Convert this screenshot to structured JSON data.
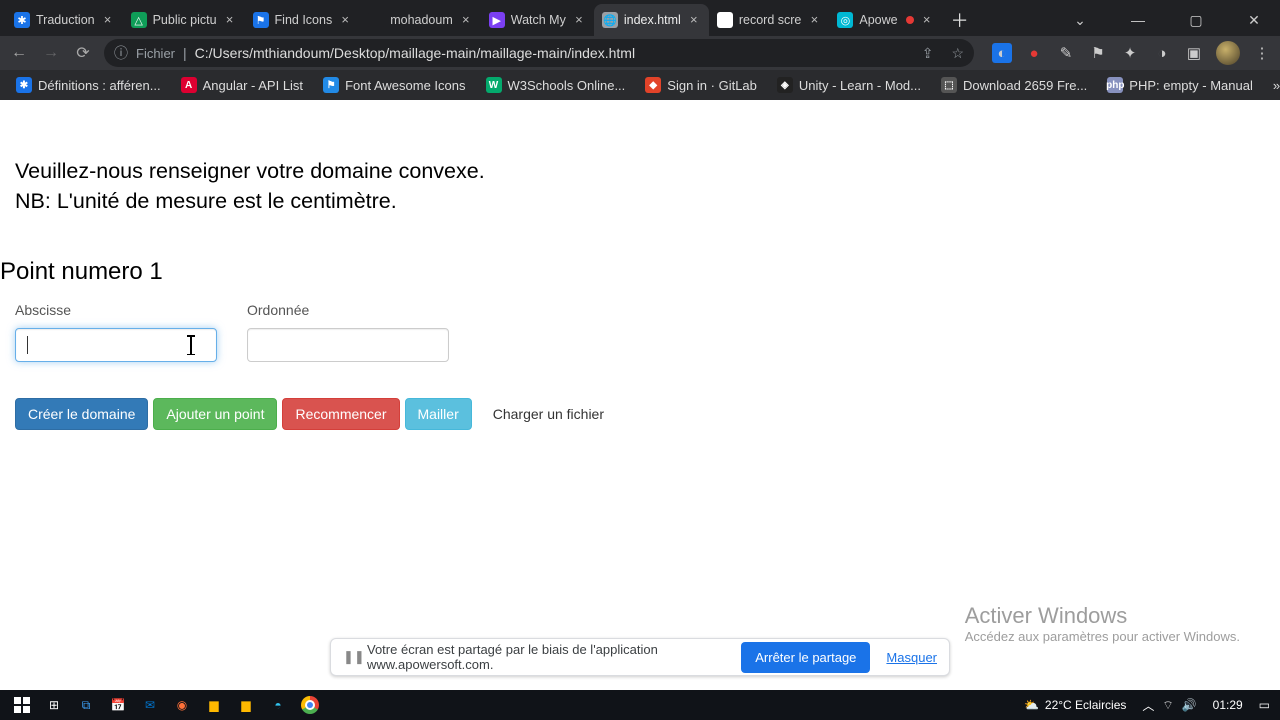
{
  "browser": {
    "tabs": [
      {
        "title": "Traduction",
        "favicon_bg": "#1a73e8",
        "favicon_glyph": "✱"
      },
      {
        "title": "Public pictu",
        "favicon_bg": "#0f9d58",
        "favicon_glyph": "△"
      },
      {
        "title": "Find Icons",
        "favicon_bg": "#1a73e8",
        "favicon_glyph": "⚑"
      },
      {
        "title": "mohadoum",
        "favicon_bg": "#202124",
        "favicon_glyph": ""
      },
      {
        "title": "Watch My",
        "favicon_bg": "#7b3ff2",
        "favicon_glyph": "▶"
      },
      {
        "title": "index.html",
        "favicon_bg": "#9aa0a6",
        "favicon_glyph": "🌐",
        "active": true
      },
      {
        "title": "record scre",
        "favicon_bg": "#fff",
        "favicon_glyph": "G"
      },
      {
        "title": "Apowe",
        "favicon_bg": "#00b8d4",
        "favicon_glyph": "◎",
        "rec": true
      }
    ],
    "url_proto": "Fichier",
    "url_path": "C:/Users/mthiandoum/Desktop/maillage-main/maillage-main/index.html",
    "bookmarks": [
      {
        "label": "Définitions : afféren...",
        "ico_bg": "#1a73e8",
        "glyph": "✱"
      },
      {
        "label": "Angular - API List",
        "ico_bg": "#dd0031",
        "glyph": "A"
      },
      {
        "label": "Font Awesome Icons",
        "ico_bg": "#228ae6",
        "glyph": "⚑"
      },
      {
        "label": "W3Schools Online...",
        "ico_bg": "#04aa6d",
        "glyph": "W"
      },
      {
        "label": "Sign in · GitLab",
        "ico_bg": "#e24329",
        "glyph": "◆"
      },
      {
        "label": "Unity - Learn - Mod...",
        "ico_bg": "#222",
        "glyph": "◈"
      },
      {
        "label": "Download 2659 Fre...",
        "ico_bg": "#555",
        "glyph": "⬚"
      },
      {
        "label": "PHP: empty - Manual",
        "ico_bg": "#8892bf",
        "glyph": "php"
      }
    ]
  },
  "page": {
    "intro_line1": "Veuillez-nous renseigner votre domaine convexe.",
    "intro_line2": "NB: L'unité de mesure est le centimètre.",
    "heading": "Point numero 1",
    "abscisse_label": "Abscisse",
    "ordonnee_label": "Ordonnée",
    "abscisse_value": "",
    "ordonnee_value": "",
    "btn_create": "Créer le domaine",
    "btn_add": "Ajouter un point",
    "btn_reset": "Recommencer",
    "btn_mesh": "Mailler",
    "file_load": "Charger un fichier"
  },
  "watermark": {
    "line1": "Activer Windows",
    "line2": "Accédez aux paramètres pour activer Windows."
  },
  "sharebar": {
    "msg": "Votre écran est partagé par le biais de l'application www.apowersoft.com.",
    "stop": "Arrêter le partage",
    "hide": "Masquer"
  },
  "taskbar": {
    "weather": "22°C  Eclaircies",
    "clock": "01:29"
  }
}
